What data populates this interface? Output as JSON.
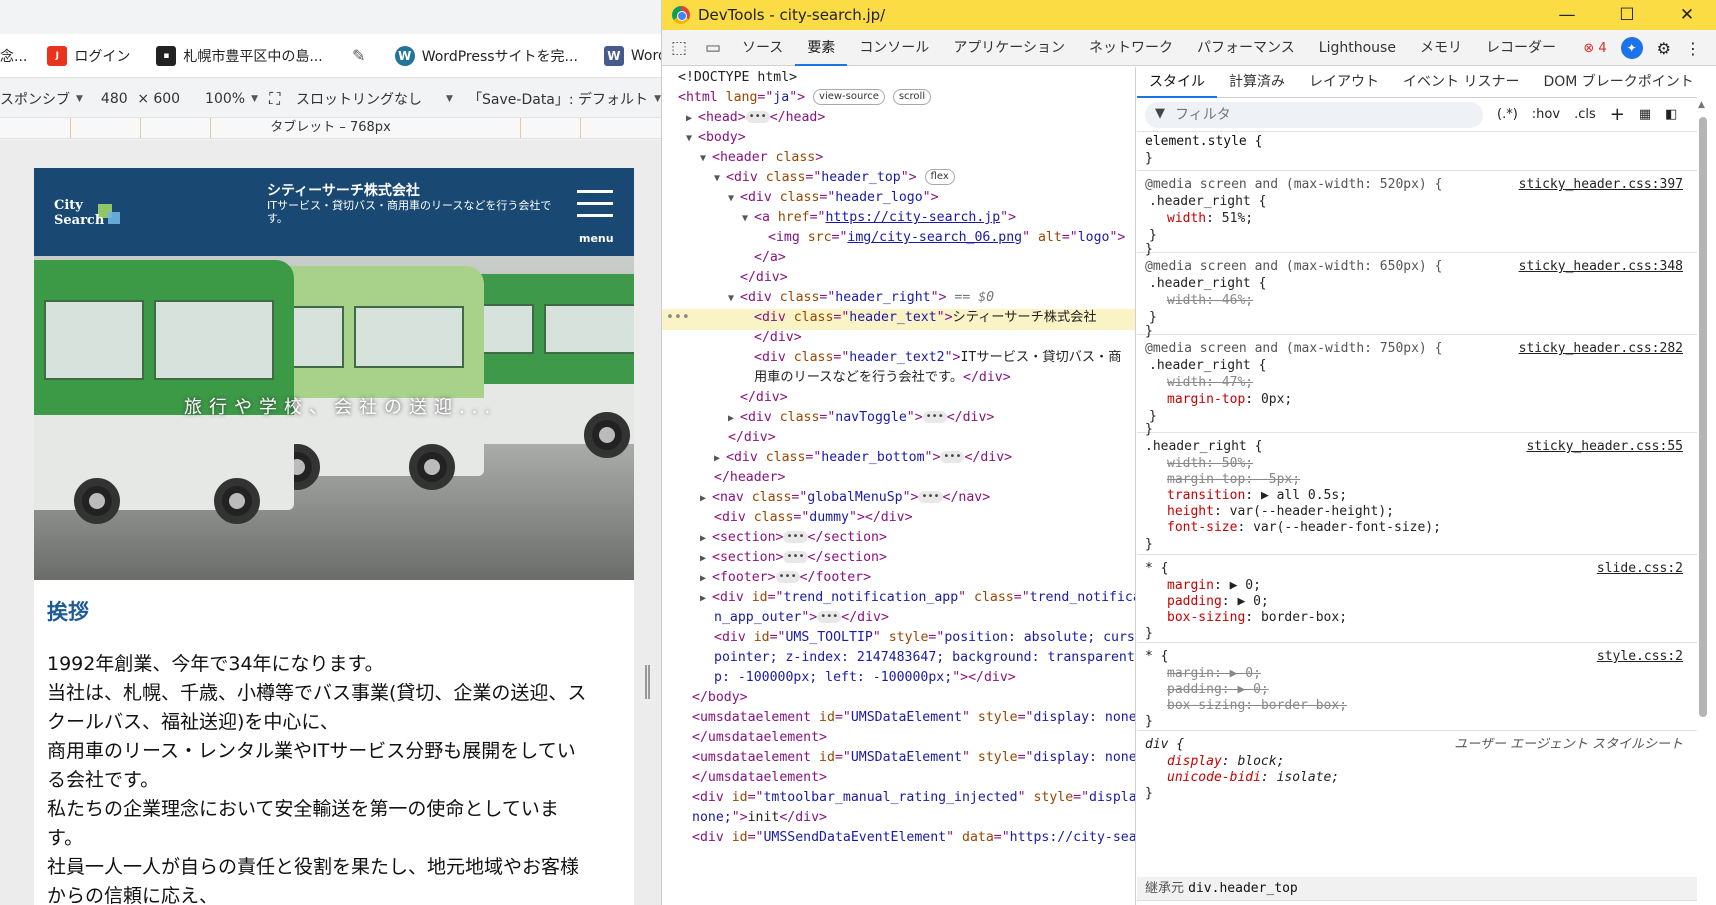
{
  "bookmarks": [
    {
      "label": "ログイン",
      "icon": "joshin-icon",
      "color": "#e8341c"
    },
    {
      "label": "札幌市豊平区中の島...",
      "icon": "site-icon",
      "color": "#222222"
    },
    {
      "label": "",
      "icon": "pen-icon",
      "color": "#555555"
    },
    {
      "label": "WordPressサイトを完...",
      "icon": "wordpress-icon",
      "color": "#21759b"
    },
    {
      "label": "Wordpress",
      "icon": "wordpress-icon-2",
      "color": "#465a8c"
    }
  ],
  "bookmark_cut": "念...",
  "emulation": {
    "device": "スポンシブ",
    "width": "480",
    "times": "×",
    "height": "600",
    "zoom": "100%",
    "throttle": "スロットリングなし",
    "savedata": "「Save-Data」: デフォルト",
    "ruler_label": "タブレット – 768px"
  },
  "site": {
    "logo": "City Search",
    "company": "シティーサーチ株式会社",
    "desc": "ITサービス・貸切バス・商用車のリースなどを行う会社です。",
    "menu_label": "menu",
    "hero_caption": "旅行や学校、会社の送迎...",
    "greet_title": "挨拶",
    "greet_lines": [
      "1992年創業、今年で34年になります。",
      "当社は、札幌、千歳、小樽等でバス事業(貸切、企業の送迎、ス",
      "クールバス、福祉送迎)を中心に、",
      "商用車のリース・レンタル業やITサービス分野も展開をしてい",
      "る会社です。",
      "私たちの企業理念において安全輸送を第一の使命としていま",
      "す。",
      "社員一人一人が自らの責任と役割を果たし、地元地域やお客様",
      "からの信頼に応え、"
    ]
  },
  "devtools": {
    "title": "DevTools - city-search.jp/",
    "tabs": [
      "ソース",
      "要素",
      "コンソール",
      "アプリケーション",
      "ネットワーク",
      "パフォーマンス",
      "Lighthouse",
      "メモリ",
      "レコーダー"
    ],
    "active_tab": "要素",
    "error_count": "4",
    "style_tabs": [
      "スタイル",
      "計算済み",
      "レイアウト",
      "イベント リスナー",
      "DOM ブレークポイント"
    ],
    "filter_placeholder": "フィルタ",
    "filter_buttons": [
      "(.*)",
      ":hov",
      ".cls"
    ],
    "inherit_label": "継承元",
    "inherit_target": "div.header_top",
    "ua_label": "ユーザー エージェント スタイルシート"
  },
  "dom": {
    "doctype": "<!DOCTYPE html>",
    "html_lang": "ja",
    "badge_view_source": "view-source",
    "badge_scroll": "scroll",
    "badge_flex": "flex",
    "link_href": "https://city-search.jp",
    "img_src": "img/city-search_06.png",
    "img_alt": "logo",
    "selected_marker": "== $0",
    "header_text": "シティーサーチ株式会社",
    "header_text2a": "ITサービス・貸切バス・商",
    "header_text2b": "用車のリースなどを行う会社です。"
  }
}
